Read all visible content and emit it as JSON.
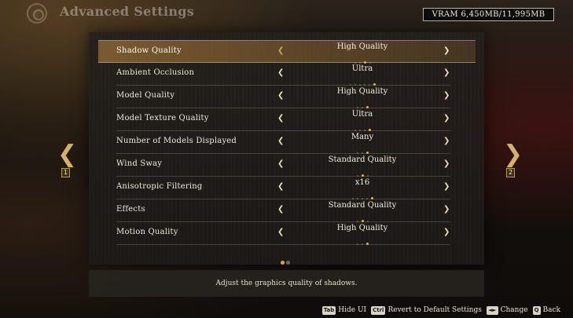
{
  "header": {
    "title": "Advanced Settings",
    "vram": "VRAM 6,450MB/11,995MB"
  },
  "navigation": {
    "prev_page_key": "1",
    "next_page_key": "2",
    "prev_arrow_icon": "chevron-left",
    "next_arrow_icon": "chevron-right"
  },
  "settings": [
    {
      "label": "Shadow Quality",
      "value": "High Quality",
      "level": 3,
      "levels": 4,
      "selected": true
    },
    {
      "label": "Ambient Occlusion",
      "value": "Ultra",
      "level": 6,
      "levels": 6,
      "selected": false
    },
    {
      "label": "Model Quality",
      "value": "High Quality",
      "level": 3,
      "levels": 3,
      "selected": false
    },
    {
      "label": "Model Texture Quality",
      "value": "Ultra",
      "level": 4,
      "levels": 4,
      "selected": false
    },
    {
      "label": "Number of Models Displayed",
      "value": "Many",
      "level": 3,
      "levels": 3,
      "selected": false
    },
    {
      "label": "Wind Sway",
      "value": "Standard Quality",
      "level": 2,
      "levels": 3,
      "selected": false
    },
    {
      "label": "Anisotropic Filtering",
      "value": "x16",
      "level": 5,
      "levels": 5,
      "selected": false
    },
    {
      "label": "Effects",
      "value": "Standard Quality",
      "level": 2,
      "levels": 3,
      "selected": false
    },
    {
      "label": "Motion Quality",
      "value": "High Quality",
      "level": 3,
      "levels": 3,
      "selected": false
    }
  ],
  "pagination": {
    "current": 1,
    "total": 2
  },
  "description": "Adjust the graphics quality of shadows.",
  "footer": {
    "hide_ui_key": "Tab",
    "hide_ui_label": "Hide UI",
    "revert_key": "Ctrl",
    "revert_label": "Revert to Default Settings",
    "change_key": "◄►",
    "change_label": "Change",
    "back_key": "Q",
    "back_label": "Back"
  },
  "colors": {
    "accent": "#d9a84c",
    "selected_row": "#96703a"
  }
}
